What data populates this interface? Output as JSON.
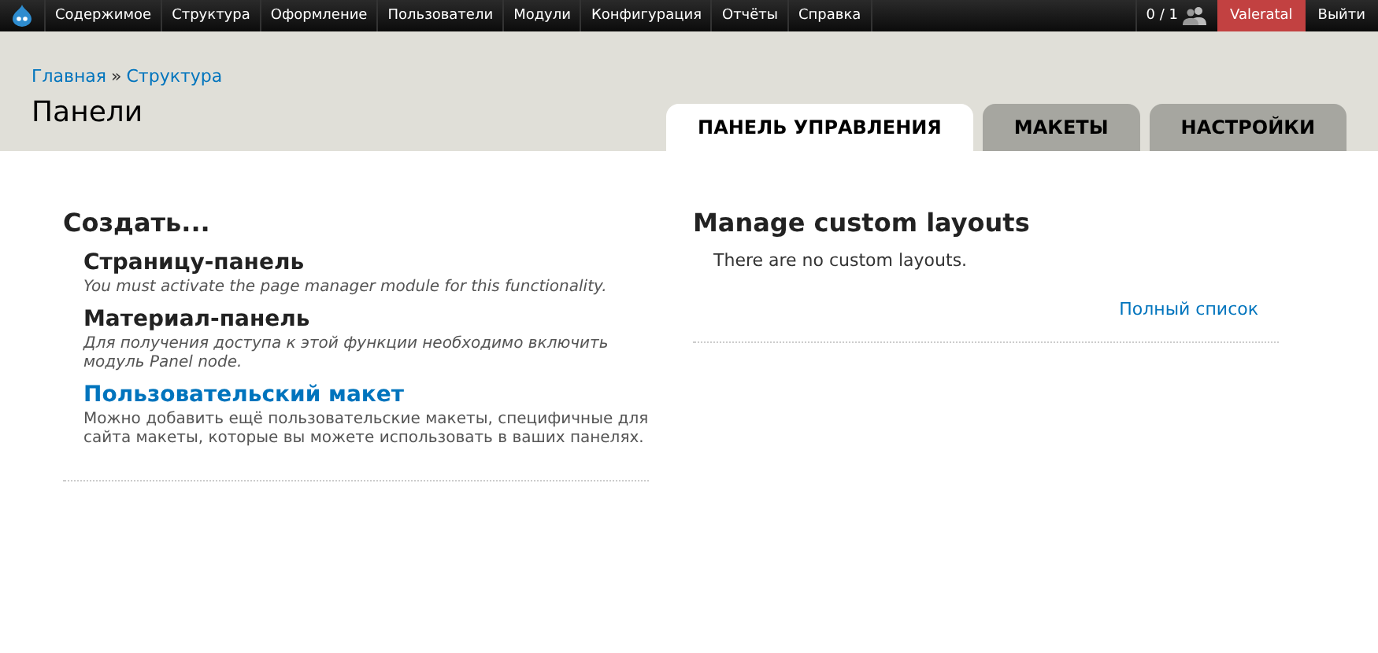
{
  "toolbar": {
    "menu": [
      "Содержимое",
      "Структура",
      "Оформление",
      "Пользователи",
      "Модули",
      "Конфигурация",
      "Отчёты",
      "Справка"
    ],
    "users_count": "0 / 1",
    "user": "Valeratal",
    "logout": "Выйти"
  },
  "breadcrumb": [
    "Главная",
    "Структура"
  ],
  "breadcrumb_separator": "»",
  "page_title": "Панели",
  "tabs": [
    {
      "label": "ПАНЕЛЬ УПРАВЛЕНИЯ",
      "selected": true
    },
    {
      "label": "МАКЕТЫ",
      "selected": false
    },
    {
      "label": "НАСТРОЙКИ",
      "selected": false
    }
  ],
  "create": {
    "title": "Создать...",
    "items": [
      {
        "kind": "unavailable",
        "title": "Страницу-панель",
        "description": "You must activate the page manager module for this functionality."
      },
      {
        "kind": "unavailable",
        "title": "Материал-панель",
        "description": "Для получения доступа к этой функции необходимо включить модуль Panel node."
      },
      {
        "kind": "link",
        "title": "Пользовательский макет",
        "description": "Можно добавить ещё пользовательские макеты, специфичные для сайта макеты, которые вы можете использовать в ваших панелях."
      }
    ]
  },
  "layouts": {
    "title": "Manage custom layouts",
    "message": "There are no custom layouts.",
    "more_link": "Полный список"
  }
}
